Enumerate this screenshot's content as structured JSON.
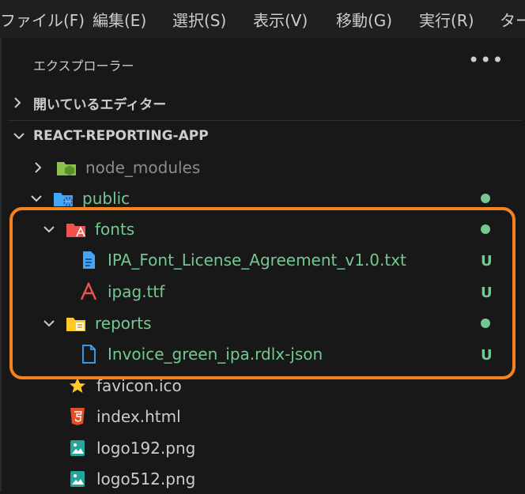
{
  "menubar": {
    "items": [
      "ファイル(F)",
      "編集(E)",
      "選択(S)",
      "表示(V)",
      "移動(G)",
      "実行(R)",
      "ター"
    ]
  },
  "explorer": {
    "title": "エクスプローラー",
    "more_icon": "ellipsis-icon",
    "open_editors_label": "開いているエディター",
    "project_label": "REACT-REPORTING-APP"
  },
  "tree": {
    "node_modules": "node_modules",
    "public": "public",
    "fonts": "fonts",
    "license_file": "IPA_Font_License_Agreement_v1.0.txt",
    "font_file": "ipag.ttf",
    "reports": "reports",
    "report_file": "Invoice_green_ipa.rdlx-json",
    "favicon": "favicon.ico",
    "index": "index.html",
    "logo192": "logo192.png",
    "logo512": "logo512.png"
  },
  "git": {
    "untracked_label": "U",
    "modified_color": "#73c991",
    "untracked_color": "#73c991"
  },
  "colors": {
    "accent_highlight": "#f5821f",
    "text_default": "#cccccc",
    "text_dim": "#8c8c8c",
    "text_git_green": "#73c991"
  }
}
